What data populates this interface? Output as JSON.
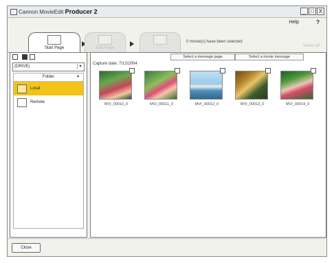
{
  "window": {
    "title_prefix": "Cannon MovieEdit",
    "title_bold": "Producer 2",
    "buttons": [
      "_",
      "□",
      "X"
    ]
  },
  "menu": {
    "help": "Help",
    "question": "?"
  },
  "steps": [
    {
      "label": "Start Page"
    },
    {
      "label": "Edit Page"
    },
    {
      "label": ""
    }
  ],
  "status_label": "0 movie(s) have been selected",
  "top_right_button": "Select all",
  "sidebar": {
    "dropdown_value": "(DRIVE)",
    "tree_header": "Folder",
    "tree_items": [
      {
        "label": "Local",
        "selected": true
      },
      {
        "label": "Remote",
        "selected": false
      }
    ]
  },
  "content": {
    "tabs": [
      "Select a message page",
      "Select a movie message"
    ],
    "date_label": "Capture date: 7/12/2004",
    "thumbnails": [
      {
        "caption": "MVI_00010_0"
      },
      {
        "caption": "MVI_00011_0"
      },
      {
        "caption": "MVI_00012_0"
      },
      {
        "caption": "MVI_00013_0"
      },
      {
        "caption": "MVI_00014_0"
      }
    ]
  },
  "bottom": {
    "close_label": "Close"
  },
  "colors": {
    "selected_item": "#f2c418",
    "window_bg": "#f2f2ec"
  }
}
